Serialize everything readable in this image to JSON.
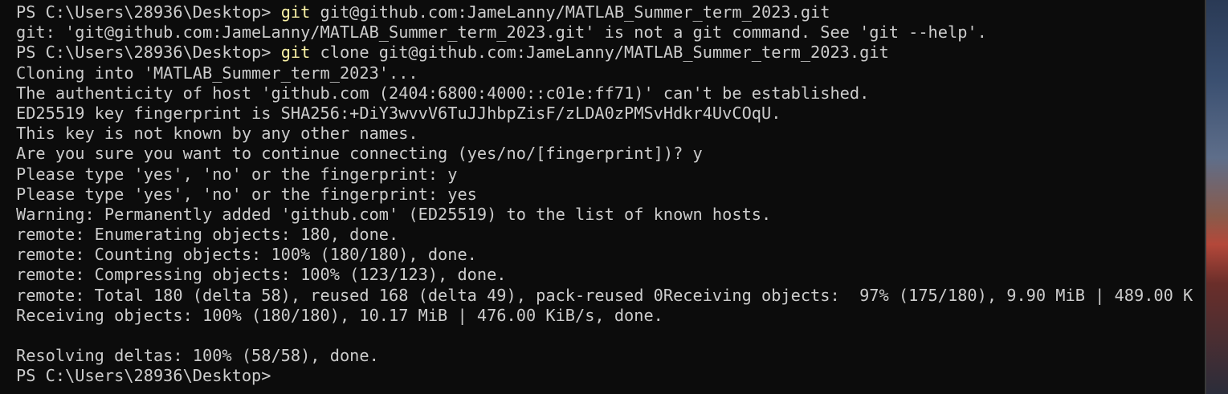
{
  "terminal": {
    "lines": [
      {
        "prompt": "PS C:\\Users\\28936\\Desktop> ",
        "cmd": "git",
        "rest": " git@github.com:JameLanny/MATLAB_Summer_term_2023.git"
      },
      {
        "text": "git: 'git@github.com:JameLanny/MATLAB_Summer_term_2023.git' is not a git command. See 'git --help'."
      },
      {
        "prompt": "PS C:\\Users\\28936\\Desktop> ",
        "cmd": "git",
        "rest": " clone git@github.com:JameLanny/MATLAB_Summer_term_2023.git"
      },
      {
        "text": "Cloning into 'MATLAB_Summer_term_2023'..."
      },
      {
        "text": "The authenticity of host 'github.com (2404:6800:4000::c01e:ff71)' can't be established."
      },
      {
        "text": "ED25519 key fingerprint is SHA256:+DiY3wvvV6TuJJhbpZisF/zLDA0zPMSvHdkr4UvCOqU."
      },
      {
        "text": "This key is not known by any other names."
      },
      {
        "text": "Are you sure you want to continue connecting (yes/no/[fingerprint])? y"
      },
      {
        "text": "Please type 'yes', 'no' or the fingerprint: y"
      },
      {
        "text": "Please type 'yes', 'no' or the fingerprint: yes"
      },
      {
        "text": "Warning: Permanently added 'github.com' (ED25519) to the list of known hosts."
      },
      {
        "text": "remote: Enumerating objects: 180, done."
      },
      {
        "text": "remote: Counting objects: 100% (180/180), done."
      },
      {
        "text": "remote: Compressing objects: 100% (123/123), done."
      },
      {
        "text": "remote: Total 180 (delta 58), reused 168 (delta 49), pack-reused 0Receiving objects:  97% (175/180), 9.90 MiB | 489.00 K"
      },
      {
        "text": "Receiving objects: 100% (180/180), 10.17 MiB | 476.00 KiB/s, done."
      },
      {
        "text": ""
      },
      {
        "text": "Resolving deltas: 100% (58/58), done."
      },
      {
        "prompt": "PS C:\\Users\\28936\\Desktop>",
        "cmd": "",
        "rest": ""
      }
    ]
  },
  "colors": {
    "background": "#0c0c0c",
    "foreground": "#cccccc",
    "command_highlight": "#f9f1a5"
  }
}
